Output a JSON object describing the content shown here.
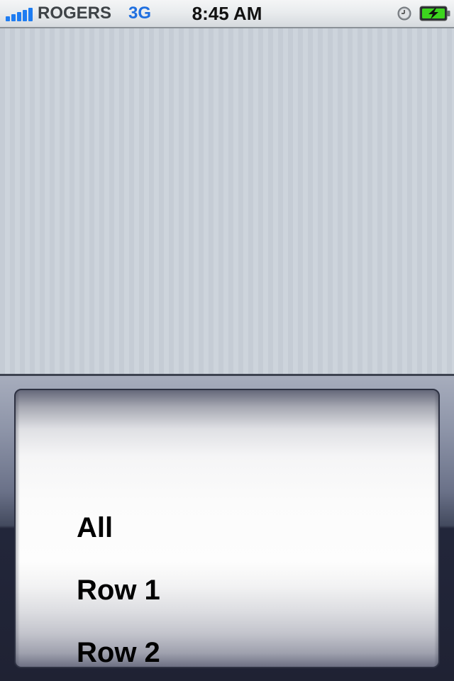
{
  "status_bar": {
    "carrier": "ROGERS",
    "network": "3G",
    "time": "8:45 AM",
    "signal_bars": 5,
    "icons": [
      "signal-strength-icon",
      "alarm-clock-icon",
      "battery-charging-icon"
    ],
    "battery_level": 1.0
  },
  "picker": {
    "rows": [
      {
        "label": "All"
      },
      {
        "label": "Row 1"
      },
      {
        "label": "Row 2"
      }
    ]
  },
  "colors": {
    "accent_blue": "#1f6fe0",
    "battery_green": "#3cd41e",
    "content_background": "#c9d0d8",
    "picker_frame": "#1f2233"
  }
}
